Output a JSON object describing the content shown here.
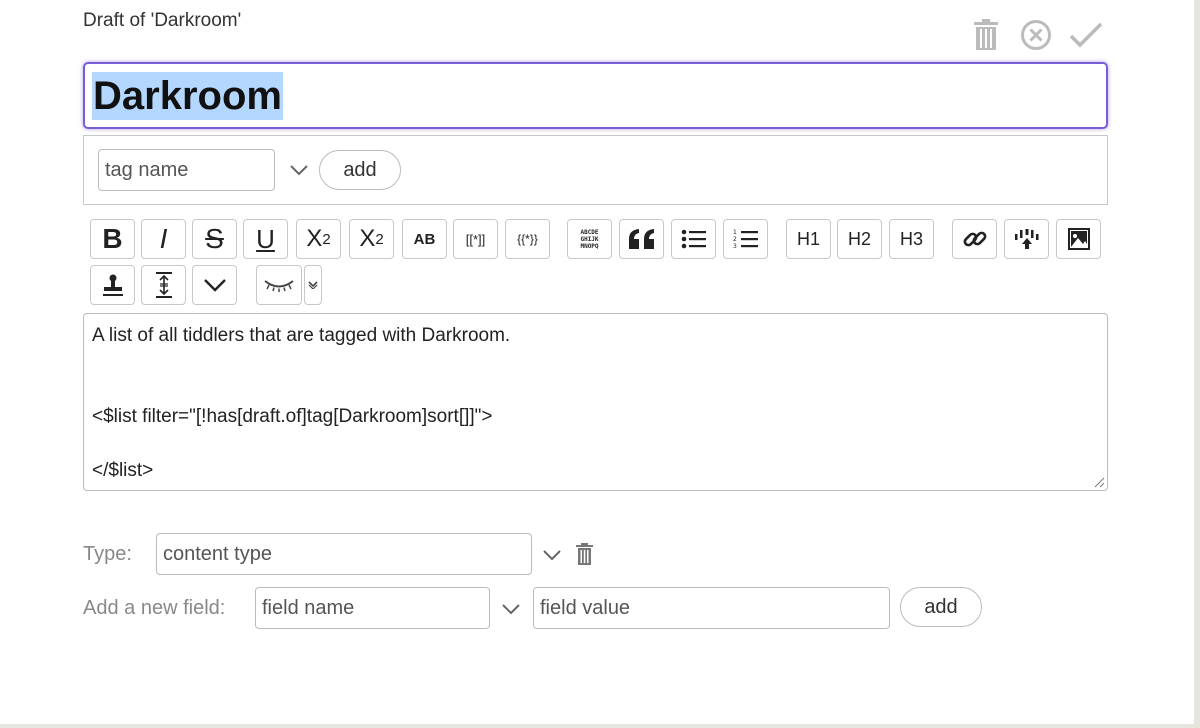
{
  "header": {
    "draft_title": "Draft of 'Darkroom'"
  },
  "controls": {
    "delete_icon": "trash-icon",
    "cancel_icon": "cancel-circle-icon",
    "save_icon": "checkmark-icon"
  },
  "title_field": {
    "value": "Darkroom"
  },
  "tags": {
    "placeholder": "tag name",
    "add_label": "add"
  },
  "toolbar": {
    "bold": "B",
    "italic": "I",
    "strike": "S",
    "underline": "U",
    "superscript_base": "X",
    "superscript_sup": "2",
    "subscript_base": "X",
    "subscript_sub": "2",
    "smallcaps": "AB",
    "wikilink": "[[*]]",
    "transclude": "{{*}}",
    "monospace_lines": [
      "ABCDE",
      "GHIJK",
      "MNOPQ"
    ],
    "h1": "H1",
    "h2": "H2",
    "h3": "H3"
  },
  "body": {
    "lines": [
      "A list of all tiddlers that are tagged with Darkroom.",
      "",
      "",
      "<$list filter=\"[!has[draft.of]tag[Darkroom]sort[]]\">",
      "",
      "</$list>"
    ]
  },
  "type_field": {
    "label": "Type:",
    "placeholder": "content type"
  },
  "new_field": {
    "label": "Add a new field:",
    "name_placeholder": "field name",
    "value_placeholder": "field value",
    "add_label": "add"
  },
  "colors": {
    "focus_border": "#7a5cd6",
    "selection": "#b4d7ff",
    "icon_gray": "#bbbbbb"
  }
}
